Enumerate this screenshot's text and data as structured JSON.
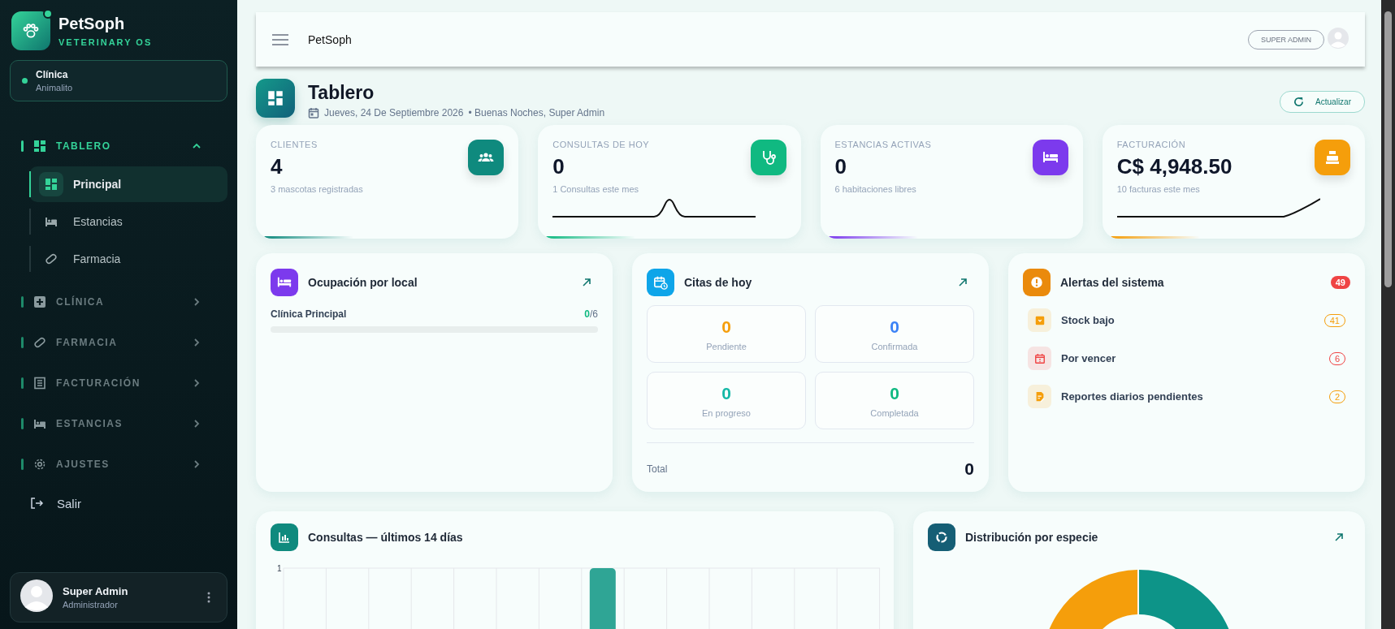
{
  "sidebar": {
    "brand": "PetSoph",
    "tagline": "VETERINARY OS",
    "clinic": {
      "label": "Clínica",
      "name": "Animalito"
    },
    "groups": [
      {
        "label": "TABLERO",
        "expanded": true,
        "children": [
          {
            "label": "Principal",
            "selected": true
          },
          {
            "label": "Estancias",
            "selected": false
          },
          {
            "label": "Farmacia",
            "selected": false
          }
        ]
      },
      {
        "label": "CLÍNICA",
        "expanded": false
      },
      {
        "label": "FARMACIA",
        "expanded": false
      },
      {
        "label": "FACTURACIÓN",
        "expanded": false
      },
      {
        "label": "ESTANCIAS",
        "expanded": false
      },
      {
        "label": "AJUSTES",
        "expanded": false
      }
    ],
    "logout": "Salir",
    "user": {
      "name": "Super Admin",
      "role": "Administrador"
    }
  },
  "topbar": {
    "title": "PetSoph",
    "role_button": "SUPER ADMIN"
  },
  "page": {
    "title": "Tablero",
    "date": "Jueves, 24 De Septiembre 2026",
    "greeting": "• Buenas Noches, Super Admin",
    "refresh_button": "Actualizar"
  },
  "stats": [
    {
      "label": "CLIENTES",
      "value": "4",
      "sub": "3 mascotas registradas",
      "color": "#0f8a7e",
      "kind": "plain"
    },
    {
      "label": "CONSULTAS DE HOY",
      "value": "0",
      "sub": "1 Consultas este mes",
      "color": "#10b981",
      "kind": "sparkline"
    },
    {
      "label": "ESTANCIAS ACTIVAS",
      "value": "0",
      "sub": "6 habitaciones libres",
      "color": "#7c3aed",
      "kind": "plain"
    },
    {
      "label": "FACTURACIÓN",
      "value": "C$ 4,948.50",
      "sub": "10 facturas este mes",
      "color": "#f59e0b",
      "kind": "sparkline"
    }
  ],
  "occupancy": {
    "title": "Ocupación por local",
    "rows": [
      {
        "name": "Clínica Principal",
        "used": "0",
        "total": "/6",
        "level": 0
      }
    ]
  },
  "appointments": {
    "title": "Citas de hoy",
    "tiles": [
      {
        "value": "0",
        "label": "Pendiente",
        "color": "#f59e0b"
      },
      {
        "value": "0",
        "label": "Confirmada",
        "color": "#3b82f6"
      },
      {
        "value": "0",
        "label": "En progreso",
        "color": "#14b8a6"
      },
      {
        "value": "0",
        "label": "Completada",
        "color": "#10b981"
      }
    ],
    "total_label": "Total",
    "total_value": "0"
  },
  "alerts": {
    "title": "Alertas del sistema",
    "count": "49",
    "items": [
      {
        "label": "Stock bajo",
        "count": "41",
        "color": "#f59e0b"
      },
      {
        "label": "Por vencer",
        "count": "6",
        "color": "#ef4444"
      },
      {
        "label": "Reportes diarios pendientes",
        "count": "2",
        "color": "#f59e0b"
      }
    ]
  },
  "consultations": {
    "title": "Consultas — últimos 14 días",
    "axis_label": "1"
  },
  "species": {
    "title": "Distribución por especie"
  }
}
